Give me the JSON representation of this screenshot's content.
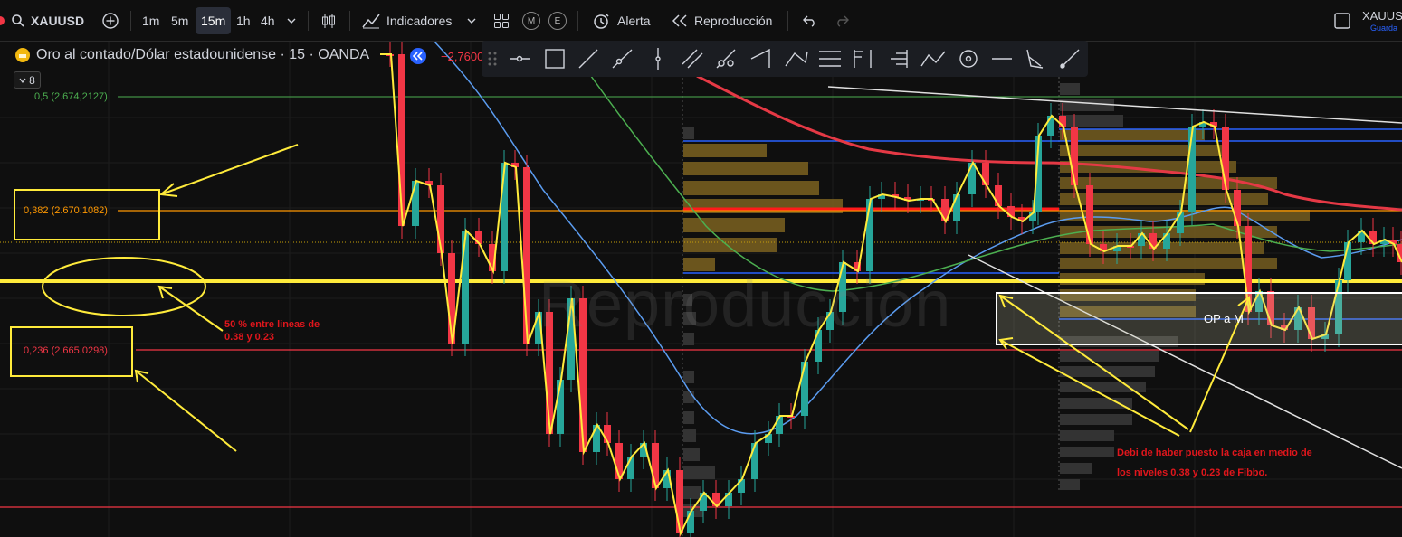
{
  "toolbar": {
    "symbol": "XAUUSD",
    "intervals": [
      "1m",
      "5m",
      "15m",
      "1h",
      "4h"
    ],
    "active_interval": "15m",
    "indicators_label": "Indicadores",
    "m_label": "M",
    "e_label": "E",
    "alert_label": "Alerta",
    "replay_label": "Reproducción",
    "right_symbol": "XAUUS",
    "right_sub": "Guarda"
  },
  "legend": {
    "title": "Oro al contado/Dólar estadounidense · 15 · OANDA",
    "change": "−2,7600",
    "collapse_count": "8"
  },
  "levels": {
    "fib_05": "0,5 (2.674,2127)",
    "fib_0382": "0,382 (2.670,1082)",
    "fib_0236": "0,236 (2.665,0298)"
  },
  "annotations": {
    "left_note_line1": "50 % entre lineas de",
    "left_note_line2": "0.38 y  0.23",
    "right_note_line1": "Debi de haber puesto la caja en medio de",
    "right_note_line2": "los niveles 0.38 y 0.23 de Fibbo.",
    "box_label": "OP a M"
  },
  "watermark": "Reproducción",
  "colors": {
    "bull": "#26a69a",
    "bear": "#f23645",
    "annotation": "#ffeb3b",
    "fib05": "#4caf50",
    "fib0382": "#ff9800",
    "fib0236": "#f23645"
  }
}
